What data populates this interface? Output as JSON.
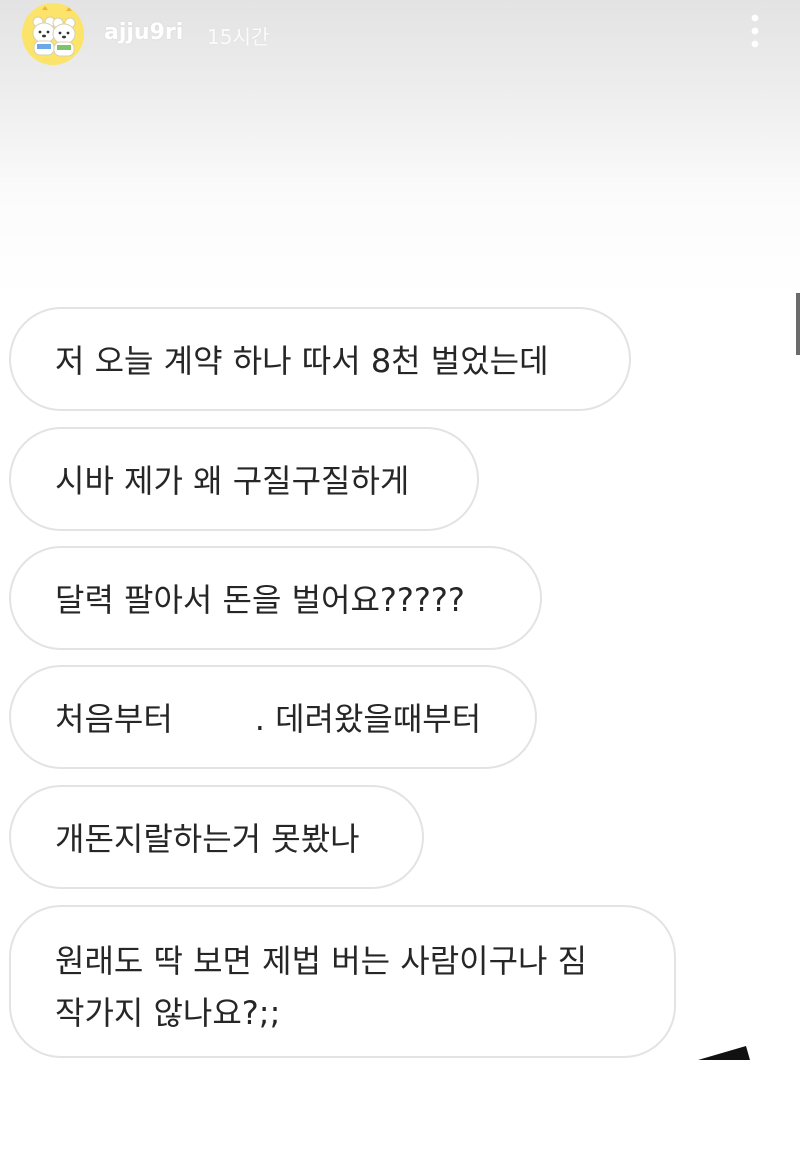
{
  "header": {
    "username": "ajju9ri",
    "time_ago": "15시간",
    "avatar_icon": "two-white-bears-avatar",
    "more_icon": "vertical-dots-icon"
  },
  "messages": [
    {
      "text": "저 오늘 계약 하나 따서 8천 벌었는데"
    },
    {
      "text": "시바 제가 왜 구질구질하게"
    },
    {
      "text": "달력 팔아서 돈을 벌어요?????"
    },
    {
      "text_before": "처음부터",
      "text_after": ". 데려왔을때부터"
    },
    {
      "text": "개돈지랄하는거 못봤나"
    },
    {
      "line1": "원래도 딱 보면 제법 버는 사람이구나 짐",
      "line2": "작가지 않나요?;;"
    }
  ],
  "colors": {
    "bubble_border": "#e3e3e3",
    "text": "#262626",
    "avatar_bg": "#fce36a"
  }
}
